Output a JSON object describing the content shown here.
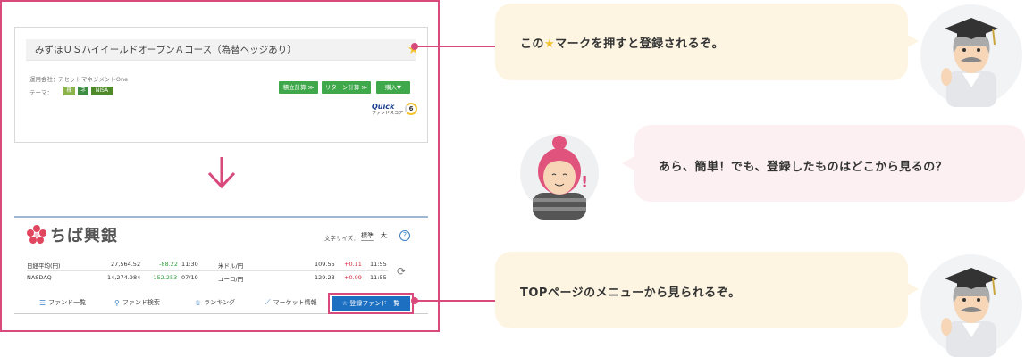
{
  "fund_card": {
    "title": "みずほＵＳハイイールドオープンＡコース（為替ヘッジあり）",
    "company_label": "運用会社：",
    "company_name": "アセットマネジメントOne",
    "theme_label": "テーマ：",
    "tags": [
      "株",
      "ネ",
      "NISA"
    ],
    "buttons": [
      "積立計算 ≫",
      "リターン計算 ≫",
      "購入▼"
    ],
    "quick_logo": "Quick",
    "quick_sub": "ファンドスコア",
    "score": "6"
  },
  "bank": {
    "name": "ちば興銀",
    "font_size_label": "文字サイズ：",
    "font_size_options": [
      "標準",
      "大"
    ],
    "help": "?",
    "markets": [
      {
        "name": "日経平均(円)",
        "value": "27,564.52",
        "change": "-88.22",
        "dir": "down",
        "time": "11:30"
      },
      {
        "name": "NASDAQ",
        "value": "14,274.984",
        "change": "-152.253",
        "dir": "down",
        "time": "07/19"
      },
      {
        "name": "米ドル/円",
        "value": "109.55",
        "change": "+0.11",
        "dir": "up",
        "time": "11:55"
      },
      {
        "name": "ユーロ/円",
        "value": "129.23",
        "change": "+0.09",
        "dir": "up",
        "time": "11:55"
      }
    ],
    "nav": [
      {
        "icon": "☰",
        "label": "ファンド一覧"
      },
      {
        "icon": "⚲",
        "label": "ファンド検索"
      },
      {
        "icon": "♕",
        "label": "ランキング"
      },
      {
        "icon": "⟋",
        "label": "マーケット情報"
      }
    ],
    "registered_button": "登録ファンド一覧"
  },
  "bubbles": {
    "first_pre": "この",
    "first_post": "マークを押すと登録されるぞ。",
    "second": "あら、簡単！でも、登録したものはどこから見るの？",
    "third": "TOPページのメニューから見られるぞ。"
  },
  "colors": {
    "accent_pink": "#d8497c",
    "star": "#f2c230",
    "button_green": "#3fa84a",
    "nav_blue": "#1d6fc2",
    "bubble_cream": "#fdf5e2",
    "bubble_pink": "#fdf0f2"
  }
}
